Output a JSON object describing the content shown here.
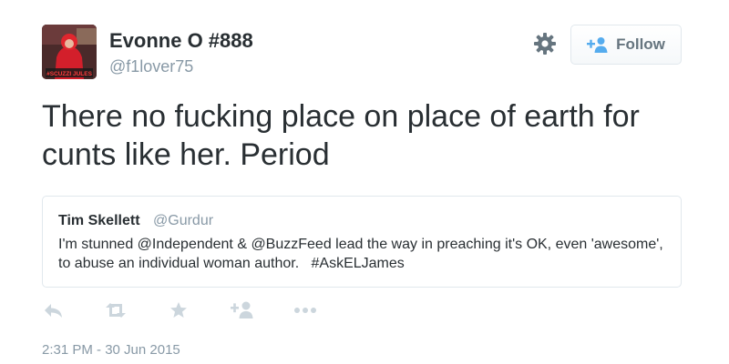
{
  "author": {
    "display_name": "Evonne O #888",
    "handle": "@f1lover75",
    "avatar_caption": "#SCUZZI JULES"
  },
  "header": {
    "follow_label": "Follow",
    "settings_icon": "gear-icon",
    "follow_icon": "add-user-icon"
  },
  "tweet": {
    "text": "There no fucking place on place of earth for cunts like her. Period"
  },
  "quoted_tweet": {
    "name": "Tim Skellett",
    "handle": "@Gurdur",
    "text": "I'm stunned @Independent & @BuzzFeed lead the way in preaching it's OK, even 'awesome', to abuse an individual woman author.   #AskELJames"
  },
  "actions": [
    {
      "icon": "reply-icon"
    },
    {
      "icon": "retweet-icon"
    },
    {
      "icon": "favorite-icon"
    },
    {
      "icon": "follow-icon"
    },
    {
      "icon": "more-icon"
    }
  ],
  "timestamp": "2:31 PM - 30 Jun 2015",
  "colors": {
    "text": "#292f33",
    "muted": "#8899a6",
    "border": "#e1e8ed",
    "icon": "#ccd6dd",
    "follow_text": "#66757f"
  }
}
